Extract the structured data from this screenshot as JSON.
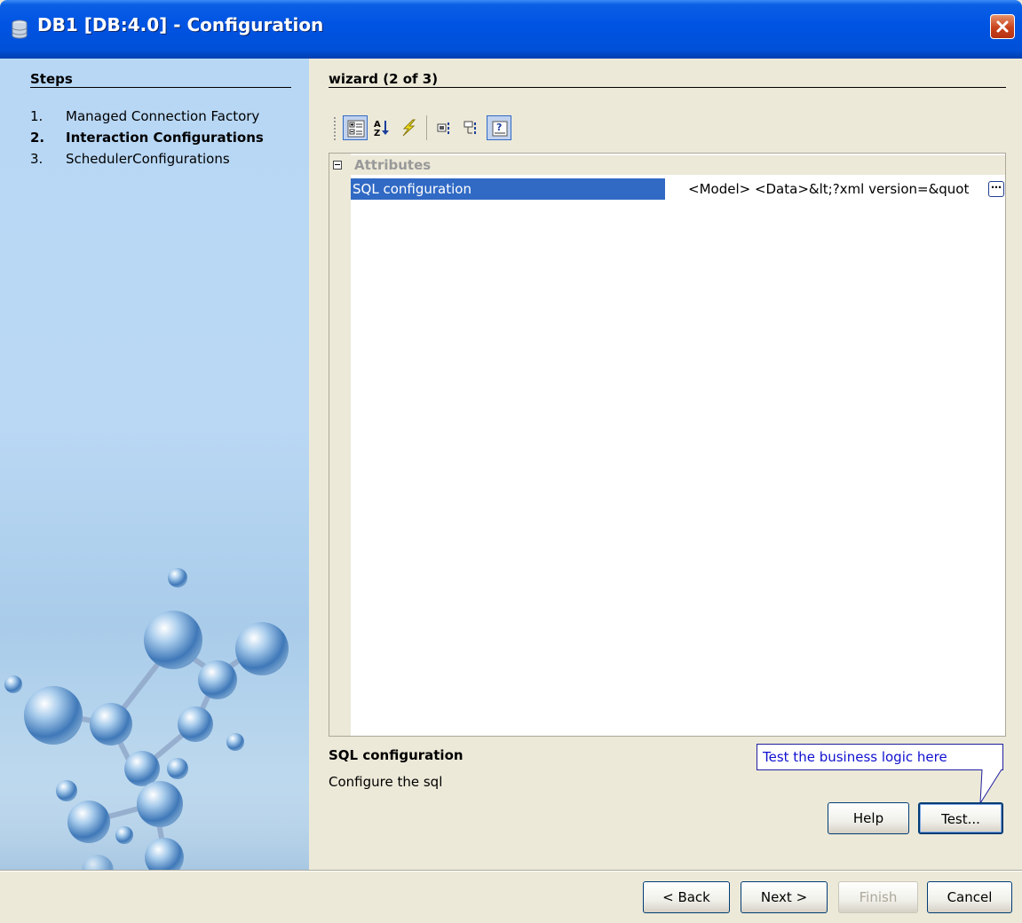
{
  "window": {
    "title": "DB1 [DB:4.0] - Configuration",
    "title_icon": "database-icon",
    "close_icon": "close-icon"
  },
  "steps": {
    "heading": "Steps",
    "items": [
      {
        "num": "1.",
        "label": "Managed Connection Factory",
        "active": false
      },
      {
        "num": "2.",
        "label": "Interaction Configurations",
        "active": true
      },
      {
        "num": "3.",
        "label": "SchedulerConfigurations",
        "active": false
      }
    ]
  },
  "wizard": {
    "heading": "wizard (2 of 3)"
  },
  "toolbar": {
    "buttons": [
      {
        "name": "categorized-view-icon",
        "pressed": true
      },
      {
        "name": "sort-alphabetically-icon",
        "pressed": false
      },
      {
        "name": "events-icon",
        "pressed": false
      },
      {
        "name": "show-expert-properties-icon",
        "pressed": false
      },
      {
        "name": "show-hidden-properties-icon",
        "pressed": false
      },
      {
        "name": "show-description-icon",
        "pressed": true
      }
    ]
  },
  "sheet": {
    "category": "Attributes",
    "property": {
      "name": "SQL configuration",
      "value": "<Model>  <Data>&lt;?xml version=&quot"
    }
  },
  "description": {
    "title": "SQL configuration",
    "text": "Configure the sql"
  },
  "callout": {
    "text": "Test the business logic here"
  },
  "buttons": {
    "help": "Help",
    "test": "Test...",
    "back": "< Back",
    "next": "Next >",
    "finish": "Finish",
    "cancel": "Cancel"
  },
  "colors": {
    "titlebar": "#0054E3",
    "selection": "#316AC5",
    "dialog_bg": "#ECE9D8",
    "callout_text": "#1010D0"
  }
}
